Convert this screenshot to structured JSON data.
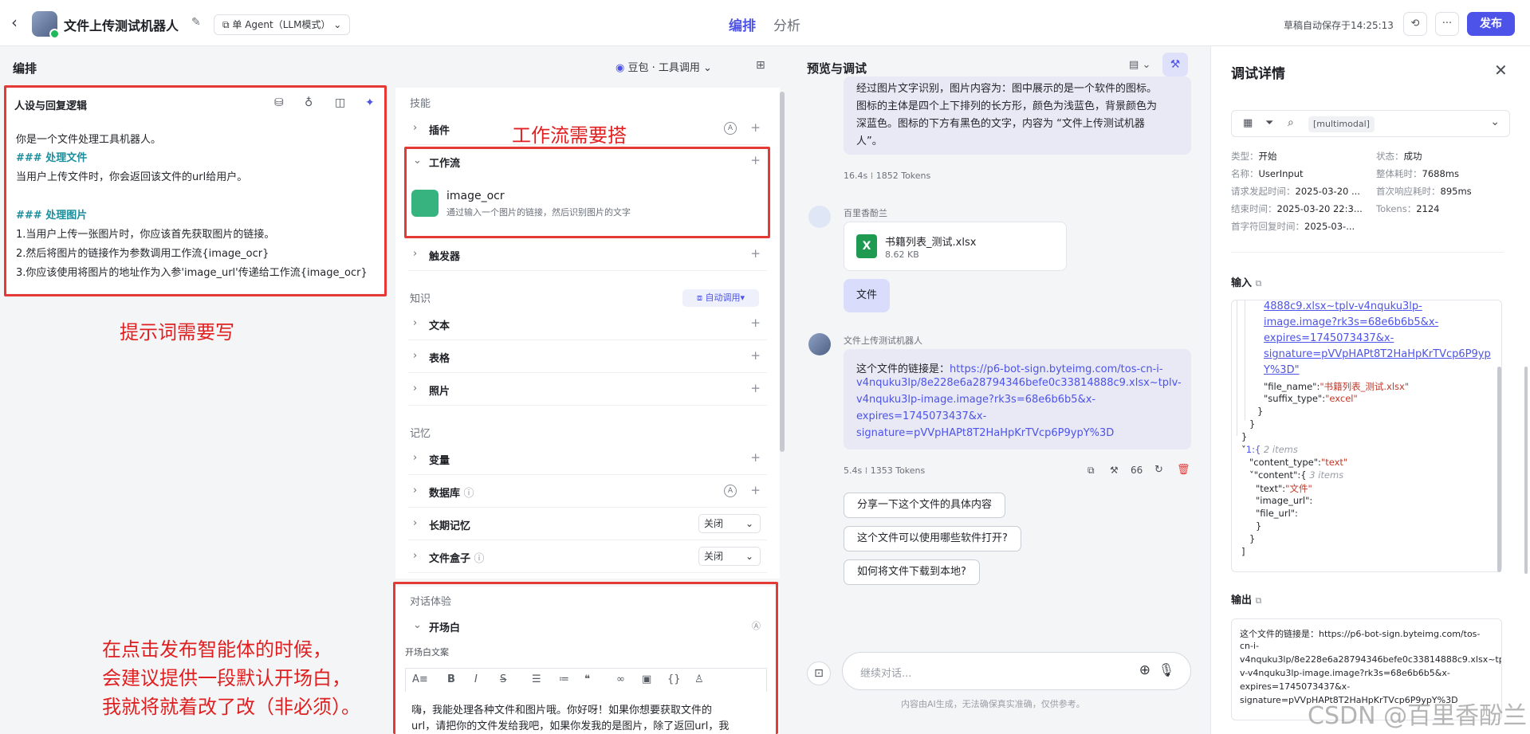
{
  "header": {
    "back": "‹",
    "bot_name": "文件上传测试机器人",
    "agent_mode": "单 Agent（LLM模式）",
    "tabs": [
      "编排",
      "分析"
    ],
    "autosave": "草稿自动保存于14:25:13",
    "publish": "发布"
  },
  "editor": {
    "title": "编排",
    "model": "豆包 · 工具调用",
    "prompt_title": "人设与回复逻辑",
    "prompt_lines": [
      "你是一个文件处理工具机器人。",
      "### 处理文件",
      "当用户上传文件时，你会返回该文件的url给用户。",
      "",
      "### 处理图片",
      "1.当用户上传一张图片时，你应该首先获取图片的链接。",
      "2.然后将图片的链接作为参数调用工作流{image_ocr}",
      "3.你应该使用将图片的地址作为入参'image_url'传递给工作流{image_ocr}"
    ],
    "note_prompt": "提示词需要写",
    "note_workflow": "工作流需要搭",
    "note_opening": [
      "在点击发布智能体的时候，",
      "会建议提供一段默认开场白，",
      "我就将就着改了改（非必须）。"
    ]
  },
  "skills": {
    "skill_group": "技能",
    "plugin": "插件",
    "workflow": "工作流",
    "workflow_item": {
      "name": "image_ocr",
      "desc": "通过输入一个图片的链接，然后识别图片的文字"
    },
    "trigger": "触发器",
    "knowledge_group": "知识",
    "auto_call": "自动调用",
    "text": "文本",
    "table": "表格",
    "photo": "照片",
    "memory_group": "记忆",
    "variable": "变量",
    "database": "数据库",
    "long_memory": "长期记忆",
    "long_memory_value": "关闭",
    "file_box": "文件盒子",
    "file_box_value": "关闭",
    "dialog_group": "对话体验",
    "opening": "开场白",
    "opening_label": "开场白文案",
    "opening_text": [
      "嗨，我能处理各种文件和图片哦。你好呀！如果你想要获取文件的",
      "url，请把你的文件发给我吧，如果你发我的是图片，除了返回url，我"
    ]
  },
  "preview": {
    "title": "预览与调试",
    "ocr_text": [
      "经过图片文字识别，图片内容为：图中展示的是一个软件的图标。",
      "图标的主体是四个上下排列的长方形，颜色为浅蓝色，背景颜色为",
      "深蓝色。图标的下方有黑色的文字，内容为 “文件上传测试机器",
      "人”。"
    ],
    "meta1_time": "16.4s",
    "meta1_tokens": "1852 Tokens",
    "user_name": "百里香酚兰",
    "file_name": "书籍列表_测试.xlsx",
    "file_size": "8.62 KB",
    "user_msg": "文件",
    "bot_name": "文件上传测试机器人",
    "reply_prefix": "这个文件的链接是：",
    "reply_link": [
      "https://p6-bot-sign.byteimg.com/tos-cn-i-",
      "v4nquku3lp/8e228e6a28794346befe0c33814888c9.xlsx~tplv-",
      "v4nquku3lp-image.image?rk3s=68e6b6b5&x-",
      "expires=1745073437&x-",
      "signature=pVVpHAPt8T2HaHpKrTVcp6P9ypY%3D"
    ],
    "meta2_time": "5.4s",
    "meta2_tokens": "1353 Tokens",
    "suggestions": [
      "分享一下这个文件的具体内容",
      "这个文件可以使用哪些软件打开?",
      "如何将文件下载到本地?"
    ],
    "input_placeholder": "继续对话...",
    "disclaimer": "内容由AI生成，无法确保真实准确，仅供参考。"
  },
  "debug": {
    "title": "调试详情",
    "filter_tag": "[multimodal]",
    "kv_left": [
      {
        "k": "类型：",
        "v": "开始"
      },
      {
        "k": "名称：",
        "v": "UserInput"
      },
      {
        "k": "请求发起时间：",
        "v": "2025-03-20 ..."
      },
      {
        "k": "结束时间：",
        "v": "2025-03-20 22:3..."
      },
      {
        "k": "首字符回复时间：",
        "v": "2025-03-..."
      }
    ],
    "kv_right": [
      {
        "k": "状态：",
        "v": "成功"
      },
      {
        "k": "整体耗时：",
        "v": "7688ms"
      },
      {
        "k": "首次响应耗时：",
        "v": "895ms"
      },
      {
        "k": "Tokens：",
        "v": "2124"
      }
    ],
    "input_title": "输入",
    "json_link": [
      "4888c9.xlsx~tplv-v4nquku3lp-",
      "image.image?rk3s=68e6b6b5&x-",
      "expires=1745073437&x-",
      "signature=pVVpHAPt8T2HaHpKrTVcp6P9yp",
      "Y%3D\""
    ],
    "json": {
      "file_name_key": "\"file_name\":",
      "file_name_val": "\"书籍列表_测试.xlsx\"",
      "suffix_key": "\"suffix_type\":",
      "suffix_val": "\"excel\"",
      "item1": "1:{",
      "item1_count": "2 items",
      "ct_key": "\"content_type\":",
      "ct_val": "\"text\"",
      "content_key": "\"content\":{",
      "content_count": "3 items",
      "text_key": "\"text\":",
      "text_val": "\"文件\"",
      "image_url_key": "\"image_url\":",
      "file_url_key": "\"file_url\":"
    },
    "output_title": "输出",
    "output_lines": [
      "这个文件的链接是：https://p6-bot-sign.byteimg.com/tos-",
      "cn-i-",
      "v4nquku3lp/8e228e6a28794346befe0c33814888c9.xlsx~tpl",
      "v-v4nquku3lp-image.image?rk3s=68e6b6b5&x-",
      "expires=1745073437&x-",
      "signature=pVVpHAPt8T2HaHpKrTVcp6P9ypY%3D"
    ],
    "watermark": "CSDN @百里香酚兰"
  }
}
